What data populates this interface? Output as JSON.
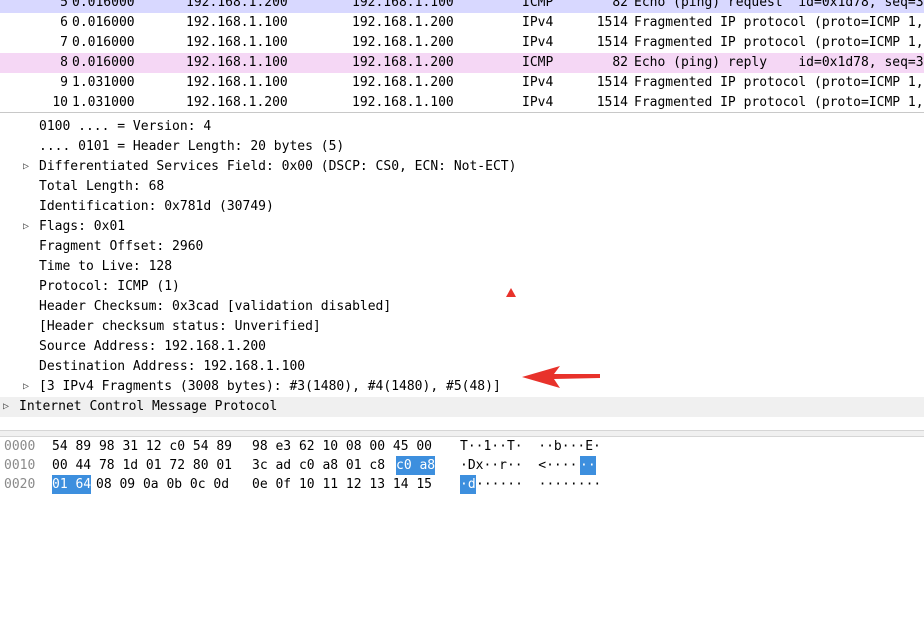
{
  "packets": [
    {
      "no": "5",
      "time": "0.016000",
      "src": "192.168.1.200",
      "dst": "192.168.1.100",
      "proto": "ICMP",
      "len": "82",
      "info": "Echo (ping) request  id=0x1d78, seq=3",
      "color": "#d8d8ff"
    },
    {
      "no": "6",
      "time": "0.016000",
      "src": "192.168.1.100",
      "dst": "192.168.1.200",
      "proto": "IPv4",
      "len": "1514",
      "info": "Fragmented IP protocol (proto=ICMP 1,",
      "color": "#ffffff"
    },
    {
      "no": "7",
      "time": "0.016000",
      "src": "192.168.1.100",
      "dst": "192.168.1.200",
      "proto": "IPv4",
      "len": "1514",
      "info": "Fragmented IP protocol (proto=ICMP 1,",
      "color": "#ffffff"
    },
    {
      "no": "8",
      "time": "0.016000",
      "src": "192.168.1.100",
      "dst": "192.168.1.200",
      "proto": "ICMP",
      "len": "82",
      "info": "Echo (ping) reply    id=0x1d78, seq=3",
      "color": "#f5d7f5"
    },
    {
      "no": "9",
      "time": "1.031000",
      "src": "192.168.1.100",
      "dst": "192.168.1.200",
      "proto": "IPv4",
      "len": "1514",
      "info": "Fragmented IP protocol (proto=ICMP 1,",
      "color": "#ffffff"
    },
    {
      "no": "10",
      "time": "1.031000",
      "src": "192.168.1.200",
      "dst": "192.168.1.100",
      "proto": "IPv4",
      "len": "1514",
      "info": "Fragmented IP protocol (proto=ICMP 1,",
      "color": "#ffffff"
    }
  ],
  "details": [
    {
      "text": "0100 .... = Version: 4",
      "indent": 1,
      "expandable": false
    },
    {
      "text": ".... 0101 = Header Length: 20 bytes (5)",
      "indent": 1,
      "expandable": false
    },
    {
      "text": "Differentiated Services Field: 0x00 (DSCP: CS0, ECN: Not-ECT)",
      "indent": 1,
      "expandable": true
    },
    {
      "text": "Total Length: 68",
      "indent": 1,
      "expandable": false
    },
    {
      "text": "Identification: 0x781d (30749)",
      "indent": 1,
      "expandable": false
    },
    {
      "text": "Flags: 0x01",
      "indent": 1,
      "expandable": true
    },
    {
      "text": "Fragment Offset: 2960",
      "indent": 1,
      "expandable": false
    },
    {
      "text": "Time to Live: 128",
      "indent": 1,
      "expandable": false
    },
    {
      "text": "Protocol: ICMP (1)",
      "indent": 1,
      "expandable": false
    },
    {
      "text": "Header Checksum: 0x3cad [validation disabled]",
      "indent": 1,
      "expandable": false
    },
    {
      "text": "[Header checksum status: Unverified]",
      "indent": 1,
      "expandable": false
    },
    {
      "text": "Source Address: 192.168.1.200",
      "indent": 1,
      "expandable": false
    },
    {
      "text": "Destination Address: 192.168.1.100",
      "indent": 1,
      "expandable": false
    },
    {
      "text": "[3 IPv4 Fragments (3008 bytes): #3(1480), #4(1480), #5(48)]",
      "indent": 1,
      "expandable": true
    },
    {
      "text": "Internet Control Message Protocol",
      "indent": 0,
      "expandable": true
    }
  ],
  "bytes": [
    {
      "offset": "0000",
      "hex1": "54 89 98 31 12 c0 54 89",
      "hex2": "98 e3 62 10 08 00 45 00",
      "ascii": "T··1··T·  ··b···E·"
    },
    {
      "offset": "0010",
      "hex1": "00 44 78 1d 01 72 80 01",
      "hex2": "3c ad c0 a8 01 c8",
      "hex_sel": "c0 a8",
      "ascii": "·Dx··r··  <·····",
      "ascii_sel": "··"
    },
    {
      "offset": "0020",
      "hex_sel": "01 64",
      "hex1": "08 09 0a 0b 0c 0d",
      "hex2": "0e 0f 10 11 12 13 14 15",
      "ascii_sel": "·d",
      "ascii": "······  ········"
    }
  ],
  "colors": {
    "annotation": "#e8322b",
    "selection": "#3d8fde"
  }
}
